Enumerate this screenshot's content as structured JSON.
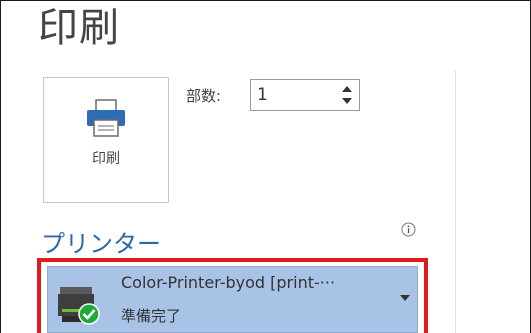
{
  "page": {
    "title": "印刷"
  },
  "print_button": {
    "label": "印刷"
  },
  "copies": {
    "label": "部数:",
    "value": "1"
  },
  "printer_section": {
    "heading": "プリンター",
    "selected_printer": {
      "name": "Color-Printer-byod [print-···",
      "status": "準備完了"
    }
  },
  "colors": {
    "accent": "#2b6aa8",
    "dropdown_background": "#a9c3e6",
    "highlight_border": "#e01b1b",
    "status_ok": "#1faa3a"
  }
}
